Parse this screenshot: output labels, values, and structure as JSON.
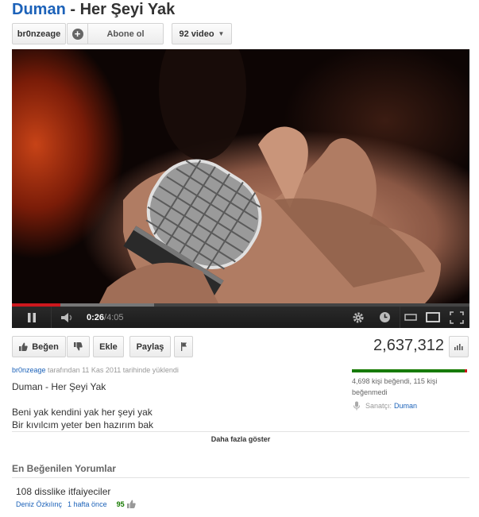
{
  "video": {
    "artist": "Duman",
    "title_sep": " - ",
    "song": "Her Şeyi Yak"
  },
  "channel": {
    "name": "br0nzeage",
    "subscribe_label": "Abone ol",
    "videos_label": "92 video"
  },
  "player": {
    "current_time": "0:26",
    "separator": " / ",
    "duration": "4:05",
    "progress_fraction": 0.106,
    "loaded_fraction": 0.31
  },
  "actions": {
    "like_label": "Beğen",
    "add_label": "Ekle",
    "share_label": "Paylaş",
    "views": "2,637,312"
  },
  "description": {
    "uploader": "br0nzeage",
    "upload_text": " tarafından 11 Kas 2011 tarihinde yüklendi",
    "title": "Duman - Her Şeyi Yak",
    "lines": [
      "Beni yak kendini yak her şeyi yak",
      "Bir kıvılcım yeter ben hazırım bak"
    ],
    "show_more": "Daha fazla göster"
  },
  "ratings": {
    "summary": "4,698 kişi beğendi, 115 kişi beğenmedi",
    "like_fraction": 0.976,
    "artist_label": "Sanatçı:",
    "artist_name": "Duman"
  },
  "comments": {
    "heading": "En Beğenilen Yorumlar",
    "items": [
      {
        "text": "108 disslike itfaiyeciler",
        "author": "Deniz Özkılınç",
        "time": "1 hafta önce",
        "score": "95"
      }
    ]
  },
  "colors": {
    "link": "#1c62b9",
    "like_green": "#167a00",
    "progress_red": "#cc181e"
  }
}
